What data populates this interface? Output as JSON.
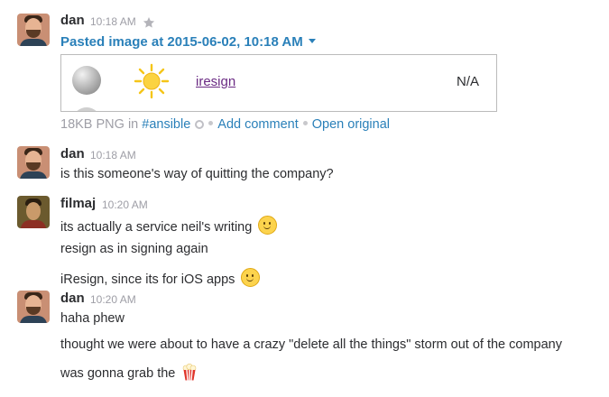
{
  "messages": [
    {
      "author": "dan",
      "time": "10:18 AM",
      "file": {
        "title": "Pasted image at 2015-06-02, 10:18 AM",
        "preview": {
          "link_text": "iresign",
          "status_text": "N/A"
        },
        "meta_prefix": "18KB PNG in ",
        "channel": "#ansible",
        "add_comment": "Add comment",
        "open_original": "Open original"
      }
    },
    {
      "author": "dan",
      "time": "10:18 AM",
      "lines": [
        "is this someone's way of quitting the company?"
      ]
    },
    {
      "author": "filmaj",
      "time": "10:20 AM",
      "lines": [
        "its actually a service neil's writing ",
        "resign as in signing again",
        "iResign, since its for iOS apps "
      ]
    },
    {
      "author": "dan",
      "time": "10:20 AM",
      "lines": [
        "haha phew",
        "thought we were about to have a crazy \"delete all the things\" storm out of the company",
        "was gonna grab the "
      ]
    }
  ],
  "icons": {
    "star": "star-icon",
    "caret": "caret-down-icon",
    "smile": "slightly-smiling-emoji",
    "popcorn": "popcorn-emoji",
    "channel": "channel-circle-icon"
  },
  "colors": {
    "link": "#2a80b9",
    "muted": "#9e9ea6",
    "text": "#2c2d30",
    "visited": "#6a2a83"
  }
}
